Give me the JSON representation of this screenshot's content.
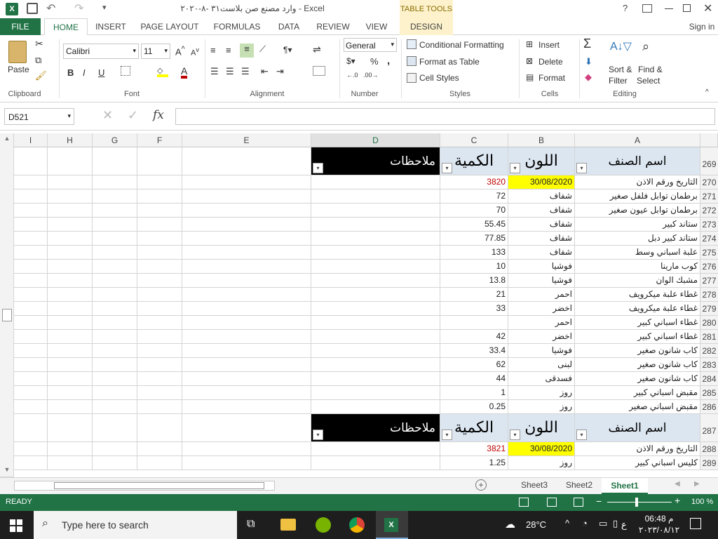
{
  "window": {
    "title": "وارد مصنع صن بلاست٣١ -٨-٢٠٢٠ - Excel",
    "table_tools": "TABLE TOOLS",
    "help": "?",
    "signin": "Sign in"
  },
  "tabs": [
    "FILE",
    "HOME",
    "INSERT",
    "PAGE LAYOUT",
    "FORMULAS",
    "DATA",
    "REVIEW",
    "VIEW",
    "DESIGN"
  ],
  "ribbon": {
    "paste": "Paste",
    "font_name": "Calibri",
    "font_size": "11",
    "number_format": "General",
    "percent": "%",
    "comma": ",",
    "conditional_formatting": "Conditional Formatting",
    "format_as_table": "Format as Table",
    "cell_styles": "Cell Styles",
    "insert": "Insert",
    "delete": "Delete",
    "format": "Format",
    "sort_filter_1": "Sort &",
    "sort_filter_2": "Filter",
    "find_select_1": "Find &",
    "find_select_2": "Select",
    "groups": {
      "clipboard": "Clipboard",
      "font": "Font",
      "alignment": "Alignment",
      "number": "Number",
      "styles": "Styles",
      "cells": "Cells",
      "editing": "Editing"
    }
  },
  "formula_bar": {
    "name_box": "D521",
    "fx": "fx",
    "value": ""
  },
  "columns": [
    "A",
    "B",
    "C",
    "D",
    "E",
    "F",
    "G",
    "H",
    "I"
  ],
  "table": {
    "header_name": "اسم الصنف",
    "header_color": "اللون",
    "header_qty": "الكمية",
    "header_notes": "ملاحظات",
    "rows": [
      {
        "row": "269",
        "kind": "header"
      },
      {
        "row": "270",
        "name": "التاريخ ورقم الاذن",
        "color": "30/08/2020",
        "qty": "3820",
        "kind": "date"
      },
      {
        "row": "271",
        "name": "برطمان توابل فلفل صغير",
        "color": "شفاف",
        "qty": "72"
      },
      {
        "row": "272",
        "name": "برطمان توابل عيون صغير",
        "color": "شفاف",
        "qty": "70"
      },
      {
        "row": "273",
        "name": "ستاند كبير",
        "color": "شفاف",
        "qty": "55.45"
      },
      {
        "row": "274",
        "name": "ستاند كبير دبل",
        "color": "شفاف",
        "qty": "77.85"
      },
      {
        "row": "275",
        "name": "علبة اسباني وسط",
        "color": "شفاف",
        "qty": "133"
      },
      {
        "row": "276",
        "name": "كوب مارينا",
        "color": "فوشيا",
        "qty": "10"
      },
      {
        "row": "277",
        "name": "مشبك الوان",
        "color": "فوشيا",
        "qty": "13.8"
      },
      {
        "row": "278",
        "name": "غطاء علبة ميكرويف",
        "color": "احمر",
        "qty": "21"
      },
      {
        "row": "279",
        "name": "غطاء علبة ميكرويف",
        "color": "اخضر",
        "qty": "33"
      },
      {
        "row": "280",
        "name": "غطاء اسباني كبير",
        "color": "احمر",
        "qty": ""
      },
      {
        "row": "281",
        "name": "غطاء اسباني كبير",
        "color": "اخضر",
        "qty": "42"
      },
      {
        "row": "282",
        "name": "كاب شانون صغير",
        "color": "فوشيا",
        "qty": "33.4"
      },
      {
        "row": "283",
        "name": "كاب شانون صغير",
        "color": "لبنى",
        "qty": "62"
      },
      {
        "row": "284",
        "name": "كاب شانون صغير",
        "color": "فسدقى",
        "qty": "44"
      },
      {
        "row": "285",
        "name": "مقبض اسباني كبير",
        "color": "روز",
        "qty": "1"
      },
      {
        "row": "286",
        "name": "مقبض اسباني صغير",
        "color": "روز",
        "qty": "0.25"
      },
      {
        "row": "287",
        "kind": "header"
      },
      {
        "row": "288",
        "name": "التاريخ ورقم الاذن",
        "color": "30/08/2020",
        "qty": "3821",
        "kind": "date"
      },
      {
        "row": "289",
        "name": "كليس اسباني كبير",
        "color": "روز",
        "qty": "1.25"
      }
    ]
  },
  "sheets": [
    "Sheet3",
    "Sheet2",
    "Sheet1"
  ],
  "status": {
    "ready": "READY",
    "zoom": "100 %"
  },
  "taskbar": {
    "search_placeholder": "Type here to search",
    "temperature": "28°C",
    "time": "06:48 م",
    "date": "٢٠٢٣/٠٨/١٢",
    "lang": "ع"
  },
  "colors": {
    "excel_green": "#217346",
    "header_blue": "#dce6f1",
    "date_yellow": "#ffff00",
    "qty_red": "#c00000"
  }
}
